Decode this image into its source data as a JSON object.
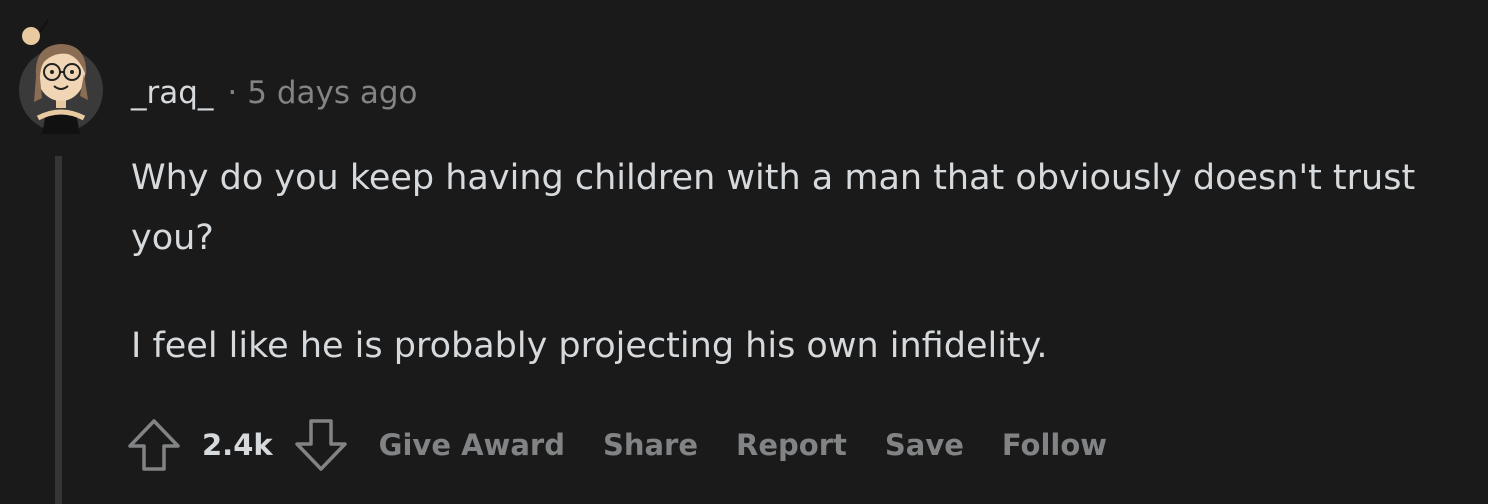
{
  "comment": {
    "author": "_raq_",
    "separator": "·",
    "timestamp": "5 days ago",
    "paragraphs": [
      "Why do you keep having children with a man that obviously doesn't trust you?",
      "I feel like he is probably projecting his own infidelity."
    ],
    "score": "2.4k",
    "actions": {
      "give_award": "Give Award",
      "share": "Share",
      "report": "Report",
      "save": "Save",
      "follow": "Follow"
    }
  },
  "icons": {
    "upvote": "upvote-arrow-icon",
    "downvote": "downvote-arrow-icon",
    "avatar": "user-avatar"
  },
  "colors": {
    "background": "#1a1a1b",
    "text": "#d7dadc",
    "muted": "#818384",
    "thread_line": "#343536"
  }
}
